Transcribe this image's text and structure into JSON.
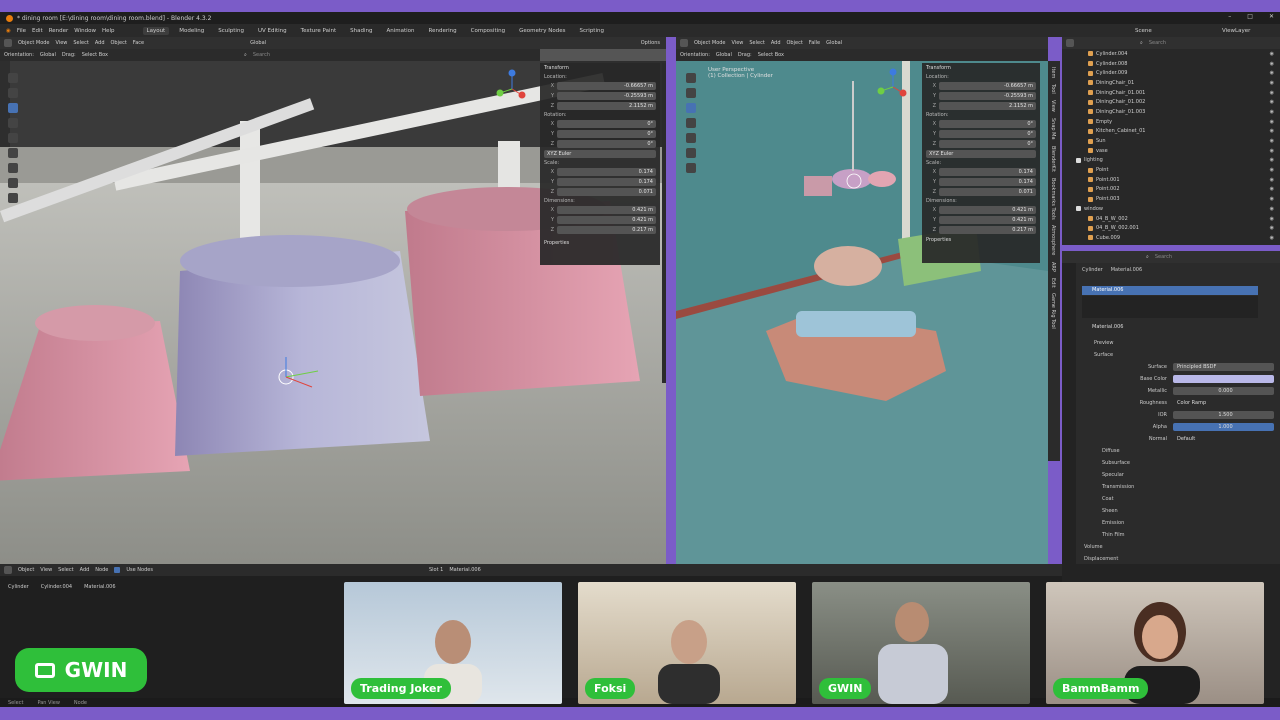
{
  "window": {
    "title": "* dining room [E:\\dining room\\dining room.blend] - Blender 4.3.2",
    "minimize": "–",
    "maximize": "□",
    "close": "✕"
  },
  "menu": {
    "items": [
      "File",
      "Edit",
      "Render",
      "Window",
      "Help"
    ],
    "workspaces": [
      "Layout",
      "Modeling",
      "Sculpting",
      "UV Editing",
      "Texture Paint",
      "Shading",
      "Animation",
      "Rendering",
      "Compositing",
      "Geometry Nodes",
      "Scripting"
    ],
    "active_workspace": "Layout",
    "scene_label": "Scene",
    "viewlayer_label": "ViewLayer"
  },
  "left_viewport": {
    "mode": "Object Mode",
    "menu": [
      "View",
      "Select",
      "Add",
      "Object",
      "Face"
    ],
    "orientation_label": "Orientation:",
    "orientation_value": "Global",
    "drag_label": "Drag:",
    "drag_value": "Select Box",
    "transform_pivot": "Global",
    "options_label": "Options",
    "search_placeholder": "Search"
  },
  "transform_panel": {
    "title": "Transform",
    "location_label": "Location:",
    "location": {
      "x": "-0.66657 m",
      "y": "-0.25593 m",
      "z": "2.1152 m"
    },
    "rotation_label": "Rotation:",
    "rotation": {
      "x": "0°",
      "y": "0°",
      "z": "0°"
    },
    "rotation_mode": "XYZ Euler",
    "scale_label": "Scale:",
    "scale": {
      "x": "0.174",
      "y": "0.174",
      "z": "0.071"
    },
    "dimensions_label": "Dimensions:",
    "dimensions": {
      "x": "0.421 m",
      "y": "0.421 m",
      "z": "0.217 m"
    },
    "properties_label": "Properties",
    "axis_labels": {
      "x": "X",
      "y": "Y",
      "z": "Z"
    }
  },
  "side_tabs": [
    "Item",
    "Tool",
    "View",
    "Snap Ma",
    "BlenderKit",
    "Bookmarks Tools",
    "Atmosphere",
    "ARP",
    "Edit",
    "Game Rig Tool"
  ],
  "right_viewport": {
    "mode": "Object Mode",
    "menu": [
      "View",
      "Select",
      "Add",
      "Object",
      "Falle"
    ],
    "overlay_title": "User Perspective",
    "overlay_subtitle": "(1) Collection | Cylinder",
    "orientation_label": "Orientation:",
    "orientation_value": "Global",
    "drag_label": "Drag:",
    "drag_value": "Select Box",
    "transform_pivot": "Global"
  },
  "outliner": {
    "search_placeholder": "Search",
    "items": [
      {
        "name": "Cylinder.004",
        "indent": 1
      },
      {
        "name": "Cylinder.008",
        "indent": 1
      },
      {
        "name": "Cylinder.009",
        "indent": 1
      },
      {
        "name": "DiningChair_01",
        "indent": 1
      },
      {
        "name": "DiningChair_01.001",
        "indent": 1
      },
      {
        "name": "DiningChair_01.002",
        "indent": 1
      },
      {
        "name": "DiningChair_01.003",
        "indent": 1
      },
      {
        "name": "Empty",
        "indent": 1
      },
      {
        "name": "Kitchen_Cabinet_01",
        "indent": 1
      },
      {
        "name": "Sun",
        "indent": 1
      },
      {
        "name": "vase",
        "indent": 1
      },
      {
        "name": "lighting",
        "indent": 0
      },
      {
        "name": "Point",
        "indent": 1
      },
      {
        "name": "Point.001",
        "indent": 1
      },
      {
        "name": "Point.002",
        "indent": 1
      },
      {
        "name": "Point.003",
        "indent": 1
      },
      {
        "name": "window",
        "indent": 0
      },
      {
        "name": "04_B_W_002",
        "indent": 1
      },
      {
        "name": "04_B_W_002.001",
        "indent": 1
      },
      {
        "name": "Cube.009",
        "indent": 1
      }
    ]
  },
  "properties": {
    "search_placeholder": "Search",
    "breadcrumb_object": "Cylinder",
    "breadcrumb_material": "Material.006",
    "slot_material": "Material.006",
    "material_name": "Material.006",
    "preview_label": "Preview",
    "surface_label": "Surface",
    "surface_type_label": "Surface",
    "surface_type": "Principled BSDF",
    "base_color_label": "Base Color",
    "base_color": "#b9b8e8",
    "metallic_label": "Metallic",
    "metallic": "0.000",
    "roughness_label": "Roughness",
    "roughness": "Color Ramp",
    "ior_label": "IOR",
    "ior": "1.500",
    "alpha_label": "Alpha",
    "alpha": "1.000",
    "normal_label": "Normal",
    "normal": "Default",
    "subsections": [
      "Diffuse",
      "Subsurface",
      "Specular",
      "Transmission",
      "Coat",
      "Sheen",
      "Emission",
      "Thin Film"
    ],
    "volume_label": "Volume",
    "displacement_label": "Displacement"
  },
  "node_editor": {
    "editor_mode": "Object",
    "menu": [
      "View",
      "Select",
      "Add",
      "Node"
    ],
    "use_nodes_label": "Use Nodes",
    "slot": "Slot 1",
    "material": "Material.006",
    "breadcrumb": [
      "Cylinder",
      "Cylinder.004",
      "Material.006"
    ]
  },
  "status_bar": {
    "select": "Select",
    "pan": "Pan View",
    "node": "Node"
  },
  "cameras": [
    {
      "name": "Trading Joker"
    },
    {
      "name": "Foksi"
    },
    {
      "name": "GWIN"
    },
    {
      "name": "BammBamm"
    }
  ],
  "logo_badge": {
    "text": "GWIN"
  },
  "colors": {
    "accent": "#4772b3",
    "badge_green": "#2fbf3a",
    "stream_purple": "#7b5cc8"
  }
}
